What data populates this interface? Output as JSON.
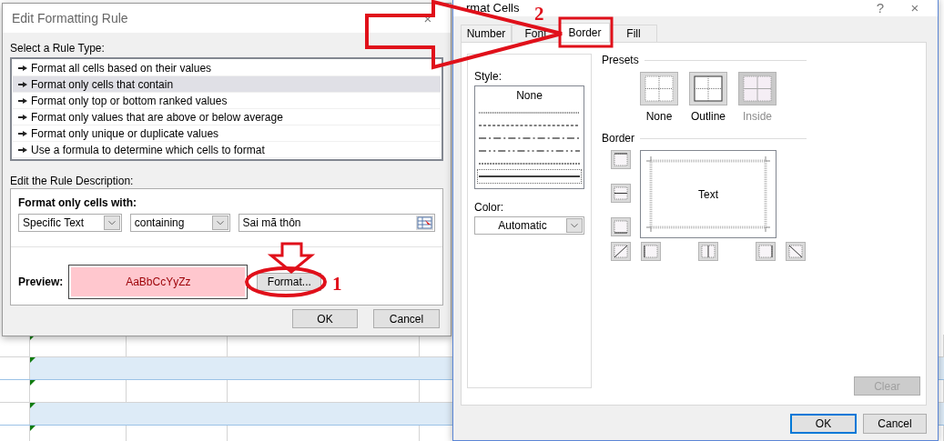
{
  "sheet": {
    "rows": [
      {
        "banded": false
      },
      {
        "banded": true
      },
      {
        "banded": false
      },
      {
        "banded": true
      },
      {
        "banded": false
      }
    ]
  },
  "edit_rule_dialog": {
    "title": "Edit Formatting Rule",
    "close": "×",
    "rule_type_label": "Select a Rule Type:",
    "rule_types": [
      {
        "label": "Format all cells based on their values",
        "selected": false
      },
      {
        "label": "Format only cells that contain",
        "selected": true
      },
      {
        "label": "Format only top or bottom ranked values",
        "selected": false
      },
      {
        "label": "Format only values that are above or below average",
        "selected": false
      },
      {
        "label": "Format only unique or duplicate values",
        "selected": false
      },
      {
        "label": "Use a formula to determine which cells to format",
        "selected": false
      }
    ],
    "description_label": "Edit the Rule Description:",
    "condition_label": "Format only cells with:",
    "dropdowns": [
      {
        "value": "Specific Text"
      },
      {
        "value": "containing"
      }
    ],
    "text_value": "Sai mã thôn",
    "preview_label": "Preview:",
    "preview_text": "AaBbCcYyZz",
    "format_button": "Format...",
    "buttons": [
      "OK",
      "Cancel"
    ]
  },
  "format_cells_dialog": {
    "title": "rmat Cells",
    "help": "?",
    "close": "×",
    "tabs": [
      {
        "label": "Number",
        "selected": false
      },
      {
        "label": "Font",
        "selected": false
      },
      {
        "label": "Border",
        "selected": true
      },
      {
        "label": "Fill",
        "selected": false
      }
    ],
    "style_label": "Style:",
    "styles": [
      {
        "kind": "none",
        "label": "None",
        "selected": false
      },
      {
        "kind": "dotted",
        "selected": false
      },
      {
        "kind": "fine-dashed",
        "selected": false
      },
      {
        "kind": "dash-dot",
        "selected": false
      },
      {
        "kind": "dash-dot-dot",
        "selected": false
      },
      {
        "kind": "dashed",
        "selected": false
      },
      {
        "kind": "solid",
        "selected": true
      }
    ],
    "color_label": "Color:",
    "color_value": "Automatic",
    "presets_label": "Presets",
    "presets": [
      {
        "kind": "none",
        "label": "None",
        "disabled": false
      },
      {
        "kind": "outline",
        "label": "Outline",
        "disabled": false
      },
      {
        "kind": "inside",
        "label": "Inside",
        "disabled": true
      }
    ],
    "border_label": "Border",
    "preview_text": "Text",
    "clear_button": {
      "label": "Clear",
      "disabled": true
    },
    "buttons": [
      {
        "label": "OK",
        "default": true
      },
      {
        "label": "Cancel",
        "default": false
      }
    ]
  },
  "annotations": [
    {
      "label": "1"
    },
    {
      "label": "2"
    }
  ]
}
